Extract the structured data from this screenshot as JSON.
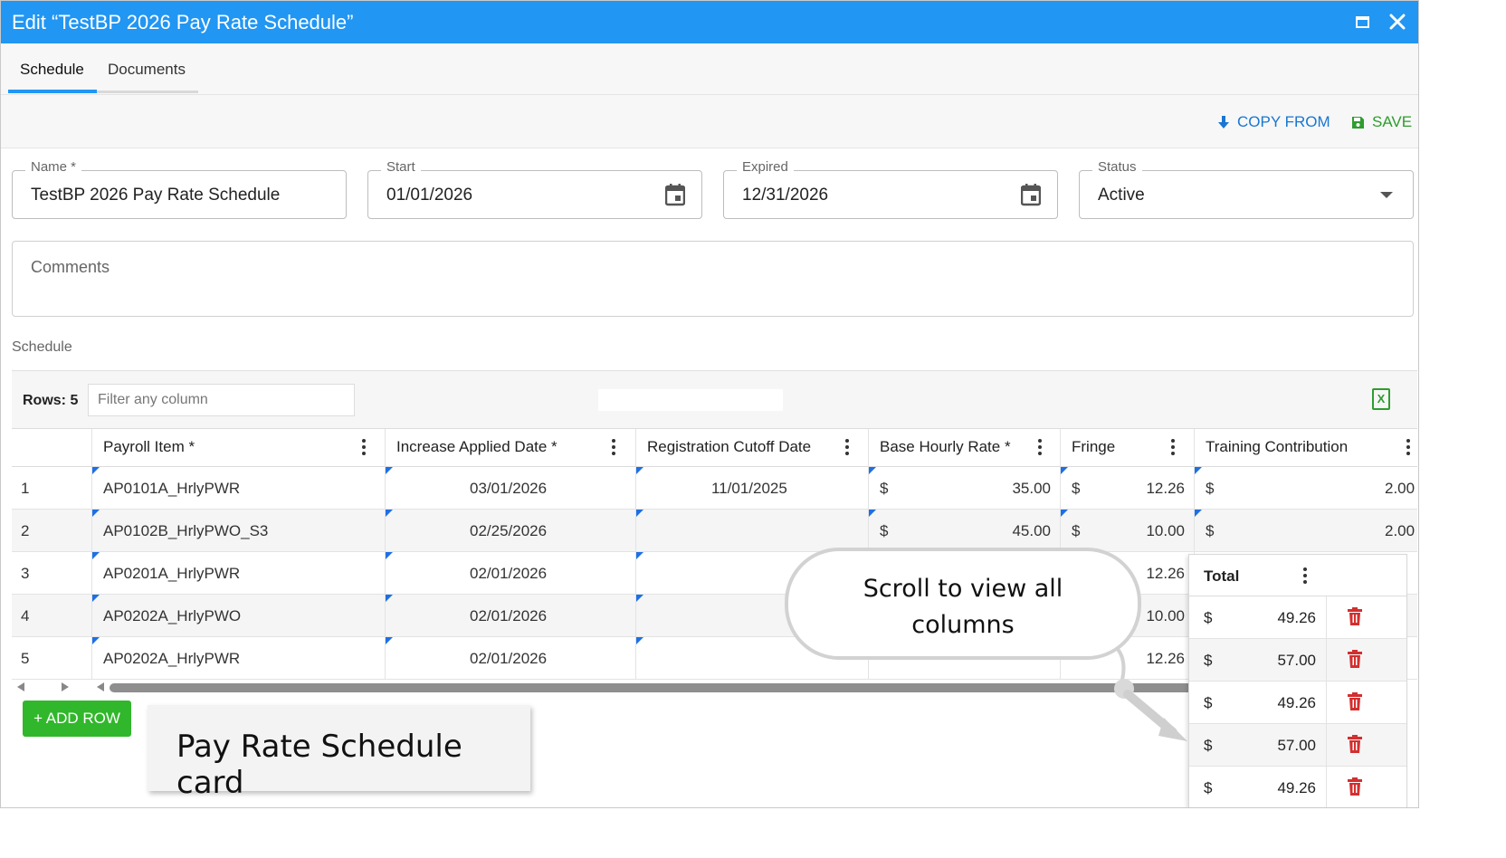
{
  "window": {
    "title": "Edit “TestBP 2026 Pay Rate Schedule”"
  },
  "tabs": [
    {
      "label": "Schedule",
      "active": true
    },
    {
      "label": "Documents",
      "active": false
    }
  ],
  "actions": {
    "copy_from": "COPY FROM",
    "save": "SAVE"
  },
  "form": {
    "name": {
      "label": "Name *",
      "value": "TestBP 2026 Pay Rate Schedule"
    },
    "start": {
      "label": "Start",
      "value": "01/01/2026"
    },
    "expired": {
      "label": "Expired",
      "value": "12/31/2026"
    },
    "status": {
      "label": "Status",
      "value": "Active"
    },
    "comments": {
      "placeholder": "Comments"
    }
  },
  "schedule": {
    "section_label": "Schedule",
    "rows_label": "Rows: 5",
    "filter_placeholder": "Filter any column",
    "columns": [
      "Payroll Item *",
      "Increase Applied Date *",
      "Registration Cutoff Date",
      "Base Hourly Rate *",
      "Fringe",
      "Training Contribution",
      "Total"
    ],
    "rows": [
      {
        "num": "1",
        "payroll_item": "AP0101A_HrlyPWR",
        "increase_date": "03/01/2026",
        "cutoff_date": "11/01/2025",
        "base_rate": "35.00",
        "fringe": "12.26",
        "training": "2.00",
        "total": "49.26"
      },
      {
        "num": "2",
        "payroll_item": "AP0102B_HrlyPWO_S3",
        "increase_date": "02/25/2026",
        "cutoff_date": "",
        "base_rate": "45.00",
        "fringe": "10.00",
        "training": "2.00",
        "total": "57.00"
      },
      {
        "num": "3",
        "payroll_item": "AP0201A_HrlyPWR",
        "increase_date": "02/01/2026",
        "cutoff_date": "",
        "base_rate": "",
        "fringe": "12.26",
        "training": "",
        "total": "49.26"
      },
      {
        "num": "4",
        "payroll_item": "AP0202A_HrlyPWO",
        "increase_date": "02/01/2026",
        "cutoff_date": "",
        "base_rate": "",
        "fringe": "10.00",
        "training": "",
        "total": "57.00"
      },
      {
        "num": "5",
        "payroll_item": "AP0202A_HrlyPWR",
        "increase_date": "02/01/2026",
        "cutoff_date": "",
        "base_rate": "",
        "fringe": "12.26",
        "training": "",
        "total": "49.26"
      }
    ],
    "currency_symbol": "$",
    "add_row": "+ ADD ROW"
  },
  "annotations": {
    "card_label": "Pay Rate Schedule card",
    "callout_line1": "Scroll to view all",
    "callout_line2": "columns"
  },
  "colors": {
    "titlebar": "#2196f3",
    "accent_blue": "#1976d2",
    "save_green": "#2e9d2e",
    "add_row_green": "#31b72b",
    "delete_red": "#d32f2f",
    "cell_marker": "#1e6fe6"
  },
  "icons": [
    "maximize-icon",
    "close-icon",
    "download-arrow-icon",
    "save-disk-icon",
    "calendar-icon",
    "dropdown-caret-icon",
    "excel-export-icon",
    "column-menu-icon",
    "trash-icon"
  ]
}
